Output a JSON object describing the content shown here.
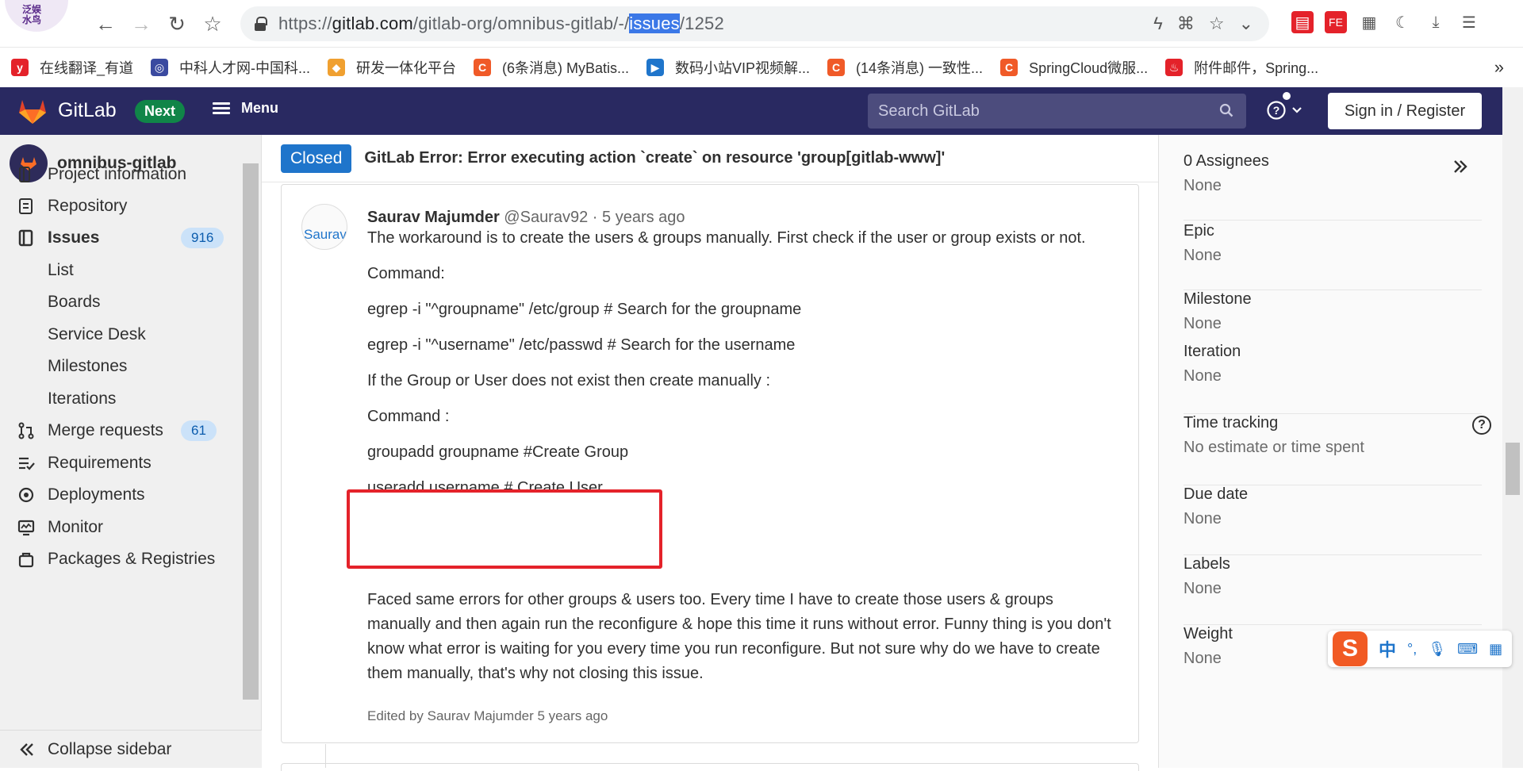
{
  "browser": {
    "url_prefix": "https://",
    "url_host": "gitlab.com",
    "url_path_before": "/gitlab-org/omnibus-gitlab/-/",
    "url_selected": "issues",
    "url_path_after": "/1252",
    "bookmarks": [
      {
        "label": "在线翻译_有道",
        "icon": "youdao-icon",
        "color": "#e4222a",
        "glyph": "y"
      },
      {
        "label": "中科人才网-中国科...",
        "icon": "cas-icon",
        "color": "#3a4aa0",
        "glyph": "◎"
      },
      {
        "label": "研发一体化平台",
        "icon": "devops-icon",
        "color": "#f0a030",
        "glyph": "◆"
      },
      {
        "label": "(6条消息) MyBatis...",
        "icon": "csdn-icon",
        "color": "#f05a28",
        "glyph": "C"
      },
      {
        "label": "数码小站VIP视频解...",
        "icon": "video-icon",
        "color": "#1f75cb",
        "glyph": "▶"
      },
      {
        "label": "(14条消息) 一致性...",
        "icon": "csdn-icon",
        "color": "#f05a28",
        "glyph": "C"
      },
      {
        "label": "SpringCloud微服...",
        "icon": "csdn-icon",
        "color": "#f05a28",
        "glyph": "C"
      },
      {
        "label": "附件邮件，Spring...",
        "icon": "fire-icon",
        "color": "#e4222a",
        "glyph": "♨"
      }
    ],
    "more": "»"
  },
  "header": {
    "brand": "GitLab",
    "next_badge": "Next",
    "menu_label": "Menu",
    "search_placeholder": "Search GitLab",
    "signin_label": "Sign in / Register"
  },
  "sidebar": {
    "project_name": "omnibus-gitlab",
    "items": [
      {
        "label": "Project information",
        "icon": "project-icon"
      },
      {
        "label": "Repository",
        "icon": "repository-icon"
      },
      {
        "label": "Issues",
        "icon": "issues-icon",
        "badge": "916"
      },
      {
        "label": "List"
      },
      {
        "label": "Boards"
      },
      {
        "label": "Service Desk"
      },
      {
        "label": "Milestones"
      },
      {
        "label": "Iterations"
      },
      {
        "label": "Merge requests",
        "icon": "merge-request-icon",
        "badge": "61"
      },
      {
        "label": "Requirements",
        "icon": "requirements-icon"
      },
      {
        "label": "Deployments",
        "icon": "deployments-icon"
      },
      {
        "label": "Monitor",
        "icon": "monitor-icon"
      },
      {
        "label": "Packages & Registries",
        "icon": "package-icon"
      }
    ],
    "collapse_label": "Collapse sidebar"
  },
  "issue": {
    "status": "Closed",
    "title": "GitLab Error: Error executing action `create` on resource 'group[gitlab-www]'",
    "note": {
      "avatar_alt": "Saurav",
      "author": "Saurav Majumder",
      "handle": "@Saurav92",
      "separator": "·",
      "time": "5 years ago",
      "lines": [
        "The workaround is to create the users & groups manually. First check if the user or group exists or not.",
        "Command:",
        "egrep -i \"^groupname\" /etc/group # Search for the groupname",
        "egrep -i \"^username\" /etc/passwd # Search for the username",
        "If the Group or User does not exist then create manually :",
        "Command :",
        "groupadd groupname #Create Group",
        "useradd username # Create User"
      ],
      "paragraph": "Faced same errors for other groups & users too. Every time I have to create those users & groups manually and then again run the reconfigure & hope this time it runs without error. Funny thing is you don't know what error is waiting for you every time you run reconfigure. But not sure why do we have to create them manually, that's why not closing this issue.",
      "edited": "Edited by Saurav Majumder 5 years ago"
    }
  },
  "right_sidebar": {
    "blocks": [
      {
        "title": "0 Assignees",
        "value": "None"
      },
      {
        "title": "Epic",
        "value": "None"
      },
      {
        "title": "Milestone",
        "value": "None"
      },
      {
        "title": "Iteration",
        "value": "None"
      },
      {
        "title": "Time tracking",
        "value": "No estimate or time spent"
      },
      {
        "title": "Due date",
        "value": "None"
      },
      {
        "title": "Labels",
        "value": "None"
      },
      {
        "title": "Weight",
        "value": "None"
      }
    ]
  },
  "ime": {
    "logo": "S",
    "mode": "中",
    "punct": "°,"
  },
  "colors": {
    "gitlab_nav": "#292961",
    "closed_badge": "#1f75cb",
    "highlight_box": "#e4222a",
    "next_badge": "#108548"
  }
}
